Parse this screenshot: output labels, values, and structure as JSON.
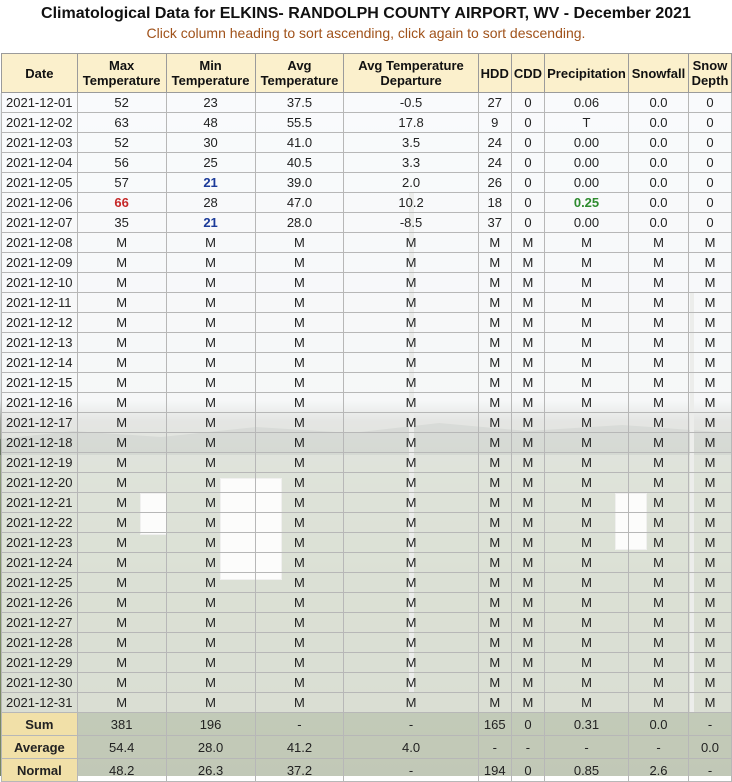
{
  "title": "Climatological Data for ELKINS- RANDOLPH COUNTY AIRPORT, WV - December 2021",
  "subtitle": "Click column heading to sort ascending, click again to sort descending.",
  "columns": [
    {
      "key": "date",
      "label_lines": [
        "Date"
      ]
    },
    {
      "key": "max",
      "label_lines": [
        "Max",
        "Temperature"
      ]
    },
    {
      "key": "min",
      "label_lines": [
        "Min",
        "Temperature"
      ]
    },
    {
      "key": "avg",
      "label_lines": [
        "Avg",
        "Temperature"
      ]
    },
    {
      "key": "dep",
      "label_lines": [
        "Avg Temperature",
        "Departure"
      ]
    },
    {
      "key": "hdd",
      "label_lines": [
        "HDD"
      ]
    },
    {
      "key": "cdd",
      "label_lines": [
        "CDD"
      ]
    },
    {
      "key": "precip",
      "label_lines": [
        "Precipitation"
      ]
    },
    {
      "key": "snow",
      "label_lines": [
        "Snowfall"
      ]
    },
    {
      "key": "depth",
      "label_lines": [
        "Snow",
        "Depth"
      ]
    }
  ],
  "rows": [
    {
      "date": "2021-12-01",
      "max": "52",
      "min": "23",
      "avg": "37.5",
      "dep": "-0.5",
      "hdd": "27",
      "cdd": "0",
      "precip": "0.06",
      "snow": "0.0",
      "depth": "0"
    },
    {
      "date": "2021-12-02",
      "max": "63",
      "min": "48",
      "avg": "55.5",
      "dep": "17.8",
      "hdd": "9",
      "cdd": "0",
      "precip": "T",
      "snow": "0.0",
      "depth": "0"
    },
    {
      "date": "2021-12-03",
      "max": "52",
      "min": "30",
      "avg": "41.0",
      "dep": "3.5",
      "hdd": "24",
      "cdd": "0",
      "precip": "0.00",
      "snow": "0.0",
      "depth": "0"
    },
    {
      "date": "2021-12-04",
      "max": "56",
      "min": "25",
      "avg": "40.5",
      "dep": "3.3",
      "hdd": "24",
      "cdd": "0",
      "precip": "0.00",
      "snow": "0.0",
      "depth": "0"
    },
    {
      "date": "2021-12-05",
      "max": "57",
      "min": "21",
      "avg": "39.0",
      "dep": "2.0",
      "hdd": "26",
      "cdd": "0",
      "precip": "0.00",
      "snow": "0.0",
      "depth": "0",
      "hl_min": "blue"
    },
    {
      "date": "2021-12-06",
      "max": "66",
      "min": "28",
      "avg": "47.0",
      "dep": "10.2",
      "hdd": "18",
      "cdd": "0",
      "precip": "0.25",
      "snow": "0.0",
      "depth": "0",
      "hl_max": "red",
      "hl_precip": "green"
    },
    {
      "date": "2021-12-07",
      "max": "35",
      "min": "21",
      "avg": "28.0",
      "dep": "-8.5",
      "hdd": "37",
      "cdd": "0",
      "precip": "0.00",
      "snow": "0.0",
      "depth": "0",
      "hl_min": "blue"
    },
    {
      "date": "2021-12-08",
      "max": "M",
      "min": "M",
      "avg": "M",
      "dep": "M",
      "hdd": "M",
      "cdd": "M",
      "precip": "M",
      "snow": "M",
      "depth": "M"
    },
    {
      "date": "2021-12-09",
      "max": "M",
      "min": "M",
      "avg": "M",
      "dep": "M",
      "hdd": "M",
      "cdd": "M",
      "precip": "M",
      "snow": "M",
      "depth": "M"
    },
    {
      "date": "2021-12-10",
      "max": "M",
      "min": "M",
      "avg": "M",
      "dep": "M",
      "hdd": "M",
      "cdd": "M",
      "precip": "M",
      "snow": "M",
      "depth": "M"
    },
    {
      "date": "2021-12-11",
      "max": "M",
      "min": "M",
      "avg": "M",
      "dep": "M",
      "hdd": "M",
      "cdd": "M",
      "precip": "M",
      "snow": "M",
      "depth": "M"
    },
    {
      "date": "2021-12-12",
      "max": "M",
      "min": "M",
      "avg": "M",
      "dep": "M",
      "hdd": "M",
      "cdd": "M",
      "precip": "M",
      "snow": "M",
      "depth": "M"
    },
    {
      "date": "2021-12-13",
      "max": "M",
      "min": "M",
      "avg": "M",
      "dep": "M",
      "hdd": "M",
      "cdd": "M",
      "precip": "M",
      "snow": "M",
      "depth": "M"
    },
    {
      "date": "2021-12-14",
      "max": "M",
      "min": "M",
      "avg": "M",
      "dep": "M",
      "hdd": "M",
      "cdd": "M",
      "precip": "M",
      "snow": "M",
      "depth": "M"
    },
    {
      "date": "2021-12-15",
      "max": "M",
      "min": "M",
      "avg": "M",
      "dep": "M",
      "hdd": "M",
      "cdd": "M",
      "precip": "M",
      "snow": "M",
      "depth": "M"
    },
    {
      "date": "2021-12-16",
      "max": "M",
      "min": "M",
      "avg": "M",
      "dep": "M",
      "hdd": "M",
      "cdd": "M",
      "precip": "M",
      "snow": "M",
      "depth": "M"
    },
    {
      "date": "2021-12-17",
      "max": "M",
      "min": "M",
      "avg": "M",
      "dep": "M",
      "hdd": "M",
      "cdd": "M",
      "precip": "M",
      "snow": "M",
      "depth": "M"
    },
    {
      "date": "2021-12-18",
      "max": "M",
      "min": "M",
      "avg": "M",
      "dep": "M",
      "hdd": "M",
      "cdd": "M",
      "precip": "M",
      "snow": "M",
      "depth": "M"
    },
    {
      "date": "2021-12-19",
      "max": "M",
      "min": "M",
      "avg": "M",
      "dep": "M",
      "hdd": "M",
      "cdd": "M",
      "precip": "M",
      "snow": "M",
      "depth": "M"
    },
    {
      "date": "2021-12-20",
      "max": "M",
      "min": "M",
      "avg": "M",
      "dep": "M",
      "hdd": "M",
      "cdd": "M",
      "precip": "M",
      "snow": "M",
      "depth": "M"
    },
    {
      "date": "2021-12-21",
      "max": "M",
      "min": "M",
      "avg": "M",
      "dep": "M",
      "hdd": "M",
      "cdd": "M",
      "precip": "M",
      "snow": "M",
      "depth": "M"
    },
    {
      "date": "2021-12-22",
      "max": "M",
      "min": "M",
      "avg": "M",
      "dep": "M",
      "hdd": "M",
      "cdd": "M",
      "precip": "M",
      "snow": "M",
      "depth": "M"
    },
    {
      "date": "2021-12-23",
      "max": "M",
      "min": "M",
      "avg": "M",
      "dep": "M",
      "hdd": "M",
      "cdd": "M",
      "precip": "M",
      "snow": "M",
      "depth": "M"
    },
    {
      "date": "2021-12-24",
      "max": "M",
      "min": "M",
      "avg": "M",
      "dep": "M",
      "hdd": "M",
      "cdd": "M",
      "precip": "M",
      "snow": "M",
      "depth": "M"
    },
    {
      "date": "2021-12-25",
      "max": "M",
      "min": "M",
      "avg": "M",
      "dep": "M",
      "hdd": "M",
      "cdd": "M",
      "precip": "M",
      "snow": "M",
      "depth": "M"
    },
    {
      "date": "2021-12-26",
      "max": "M",
      "min": "M",
      "avg": "M",
      "dep": "M",
      "hdd": "M",
      "cdd": "M",
      "precip": "M",
      "snow": "M",
      "depth": "M"
    },
    {
      "date": "2021-12-27",
      "max": "M",
      "min": "M",
      "avg": "M",
      "dep": "M",
      "hdd": "M",
      "cdd": "M",
      "precip": "M",
      "snow": "M",
      "depth": "M"
    },
    {
      "date": "2021-12-28",
      "max": "M",
      "min": "M",
      "avg": "M",
      "dep": "M",
      "hdd": "M",
      "cdd": "M",
      "precip": "M",
      "snow": "M",
      "depth": "M"
    },
    {
      "date": "2021-12-29",
      "max": "M",
      "min": "M",
      "avg": "M",
      "dep": "M",
      "hdd": "M",
      "cdd": "M",
      "precip": "M",
      "snow": "M",
      "depth": "M"
    },
    {
      "date": "2021-12-30",
      "max": "M",
      "min": "M",
      "avg": "M",
      "dep": "M",
      "hdd": "M",
      "cdd": "M",
      "precip": "M",
      "snow": "M",
      "depth": "M"
    },
    {
      "date": "2021-12-31",
      "max": "M",
      "min": "M",
      "avg": "M",
      "dep": "M",
      "hdd": "M",
      "cdd": "M",
      "precip": "M",
      "snow": "M",
      "depth": "M"
    }
  ],
  "summary": [
    {
      "date": "Sum",
      "max": "381",
      "min": "196",
      "avg": "-",
      "dep": "-",
      "hdd": "165",
      "cdd": "0",
      "precip": "0.31",
      "snow": "0.0",
      "depth": "-"
    },
    {
      "date": "Average",
      "max": "54.4",
      "min": "28.0",
      "avg": "41.2",
      "dep": "4.0",
      "hdd": "-",
      "cdd": "-",
      "precip": "-",
      "snow": "-",
      "depth": "0.0"
    },
    {
      "date": "Normal",
      "max": "48.2",
      "min": "26.3",
      "avg": "37.2",
      "dep": "-",
      "hdd": "194",
      "cdd": "0",
      "precip": "0.85",
      "snow": "2.6",
      "depth": "-"
    }
  ],
  "colors": {
    "header_bg": "#fbf0cc",
    "subtitle": "#a0521a",
    "record_high": "#c62828",
    "record_low": "#1b3a99",
    "record_precip": "#2e8b2e"
  }
}
